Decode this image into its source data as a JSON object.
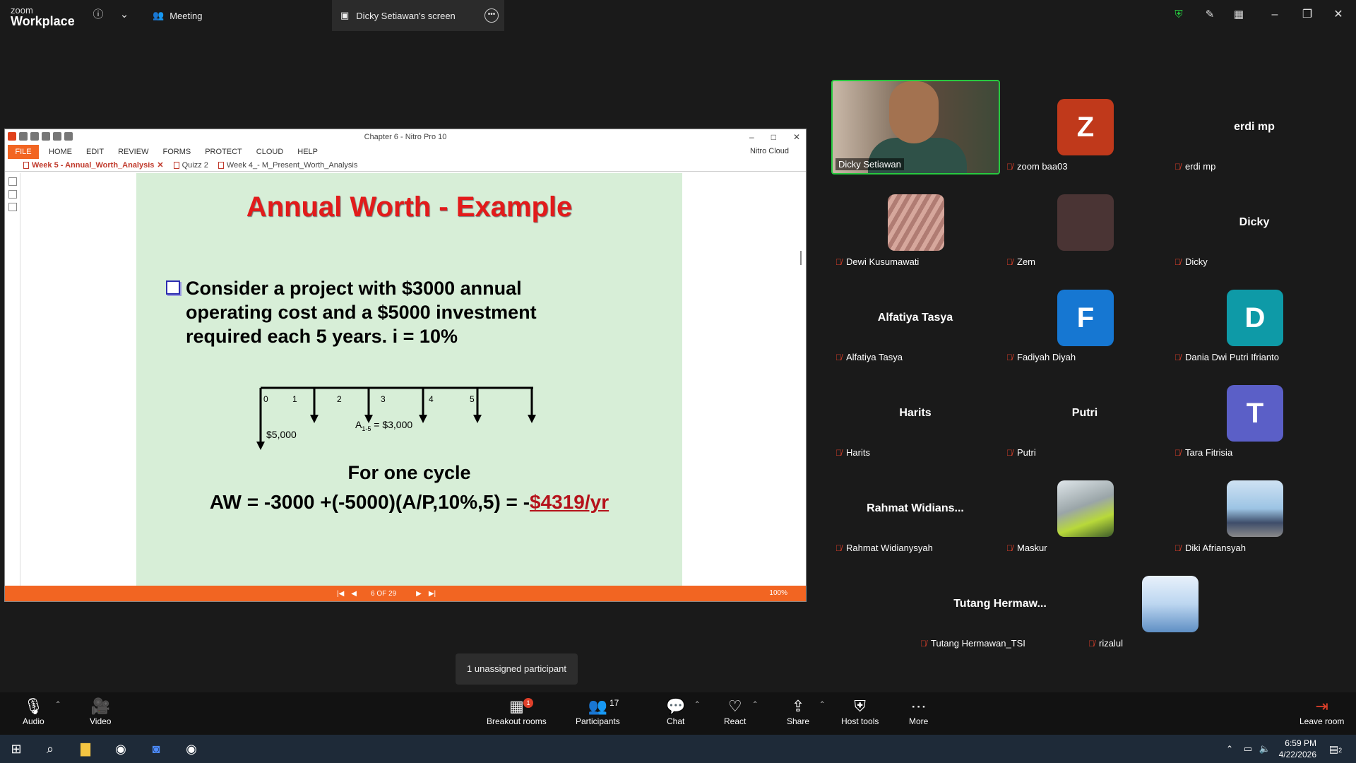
{
  "app": {
    "logo_line1": "zoom",
    "logo_line2": "Workplace"
  },
  "topbar": {
    "meeting_label": "Meeting",
    "screen_tab_label": "Dicky Setiawan's screen"
  },
  "nitro": {
    "title": "Chapter 6 - Nitro Pro 10",
    "menu": [
      "FILE",
      "HOME",
      "EDIT",
      "REVIEW",
      "FORMS",
      "PROTECT",
      "CLOUD",
      "HELP"
    ],
    "cloud_label": "Nitro Cloud",
    "tabs": [
      "Week 5 - Annual_Worth_Analysis",
      "Quizz 2",
      "Week 4_- M_Present_Worth_Analysis"
    ],
    "page_indicator": "6 OF 29",
    "zoom": "100%"
  },
  "slide": {
    "title": "Annual Worth - Example",
    "bullet": "Consider a project with $3000 annual operating cost and a $5000 investment required each 5 years.  i = 10%",
    "periods": [
      "0",
      "1",
      "2",
      "3",
      "4",
      "5"
    ],
    "investment_label": "$5,000",
    "annuity_main": "A",
    "annuity_sub": "1-5",
    "annuity_value": " = $3,000",
    "cycle_heading": "For one cycle",
    "formula_main": "AW = -3000 +(-5000)(A/P,10%,5) = -",
    "formula_answer": "$4319/yr"
  },
  "participants": [
    {
      "name": "Dicky Setiawan"
    },
    {
      "name": "zoom baa03",
      "initial": "Z",
      "color": "#c0391b"
    },
    {
      "name": "erdi mp",
      "display": "erdi mp"
    },
    {
      "name": "Dewi Kusumawati"
    },
    {
      "name": "Zem"
    },
    {
      "name": "Dicky",
      "display": "Dicky"
    },
    {
      "name": "Alfatiya Tasya",
      "display": "Alfatiya Tasya"
    },
    {
      "name": "Fadiyah Diyah",
      "initial": "F",
      "color": "#1677d2"
    },
    {
      "name": "Dania Dwi Putri Ifrianto",
      "initial": "D",
      "color": "#0e9aa7"
    },
    {
      "name": "Harits",
      "display": "Harits"
    },
    {
      "name": "Putri",
      "display": "Putri"
    },
    {
      "name": "Tara Fitrisia",
      "initial": "T",
      "color": "#5b5fc7"
    },
    {
      "name": "Rahmat Widianysyah",
      "display": "Rahmat Widians..."
    },
    {
      "name": "Maskur"
    },
    {
      "name": "Diki Afriansyah"
    },
    {
      "name": "Tutang Hermawan_TSI",
      "display": "Tutang  Hermaw..."
    },
    {
      "name": "rizalul"
    }
  ],
  "unassigned": "1 unassigned participant",
  "toolbar": {
    "audio": "Audio",
    "video": "Video",
    "breakout": "Breakout rooms",
    "breakout_badge": "1",
    "participants": "Participants",
    "participants_count": "17",
    "chat": "Chat",
    "react": "React",
    "share": "Share",
    "host_tools": "Host tools",
    "more": "More",
    "leave": "Leave room"
  },
  "taskbar": {
    "time": "6:59 PM",
    "date": "4/22/2026",
    "notif_count": "2"
  }
}
